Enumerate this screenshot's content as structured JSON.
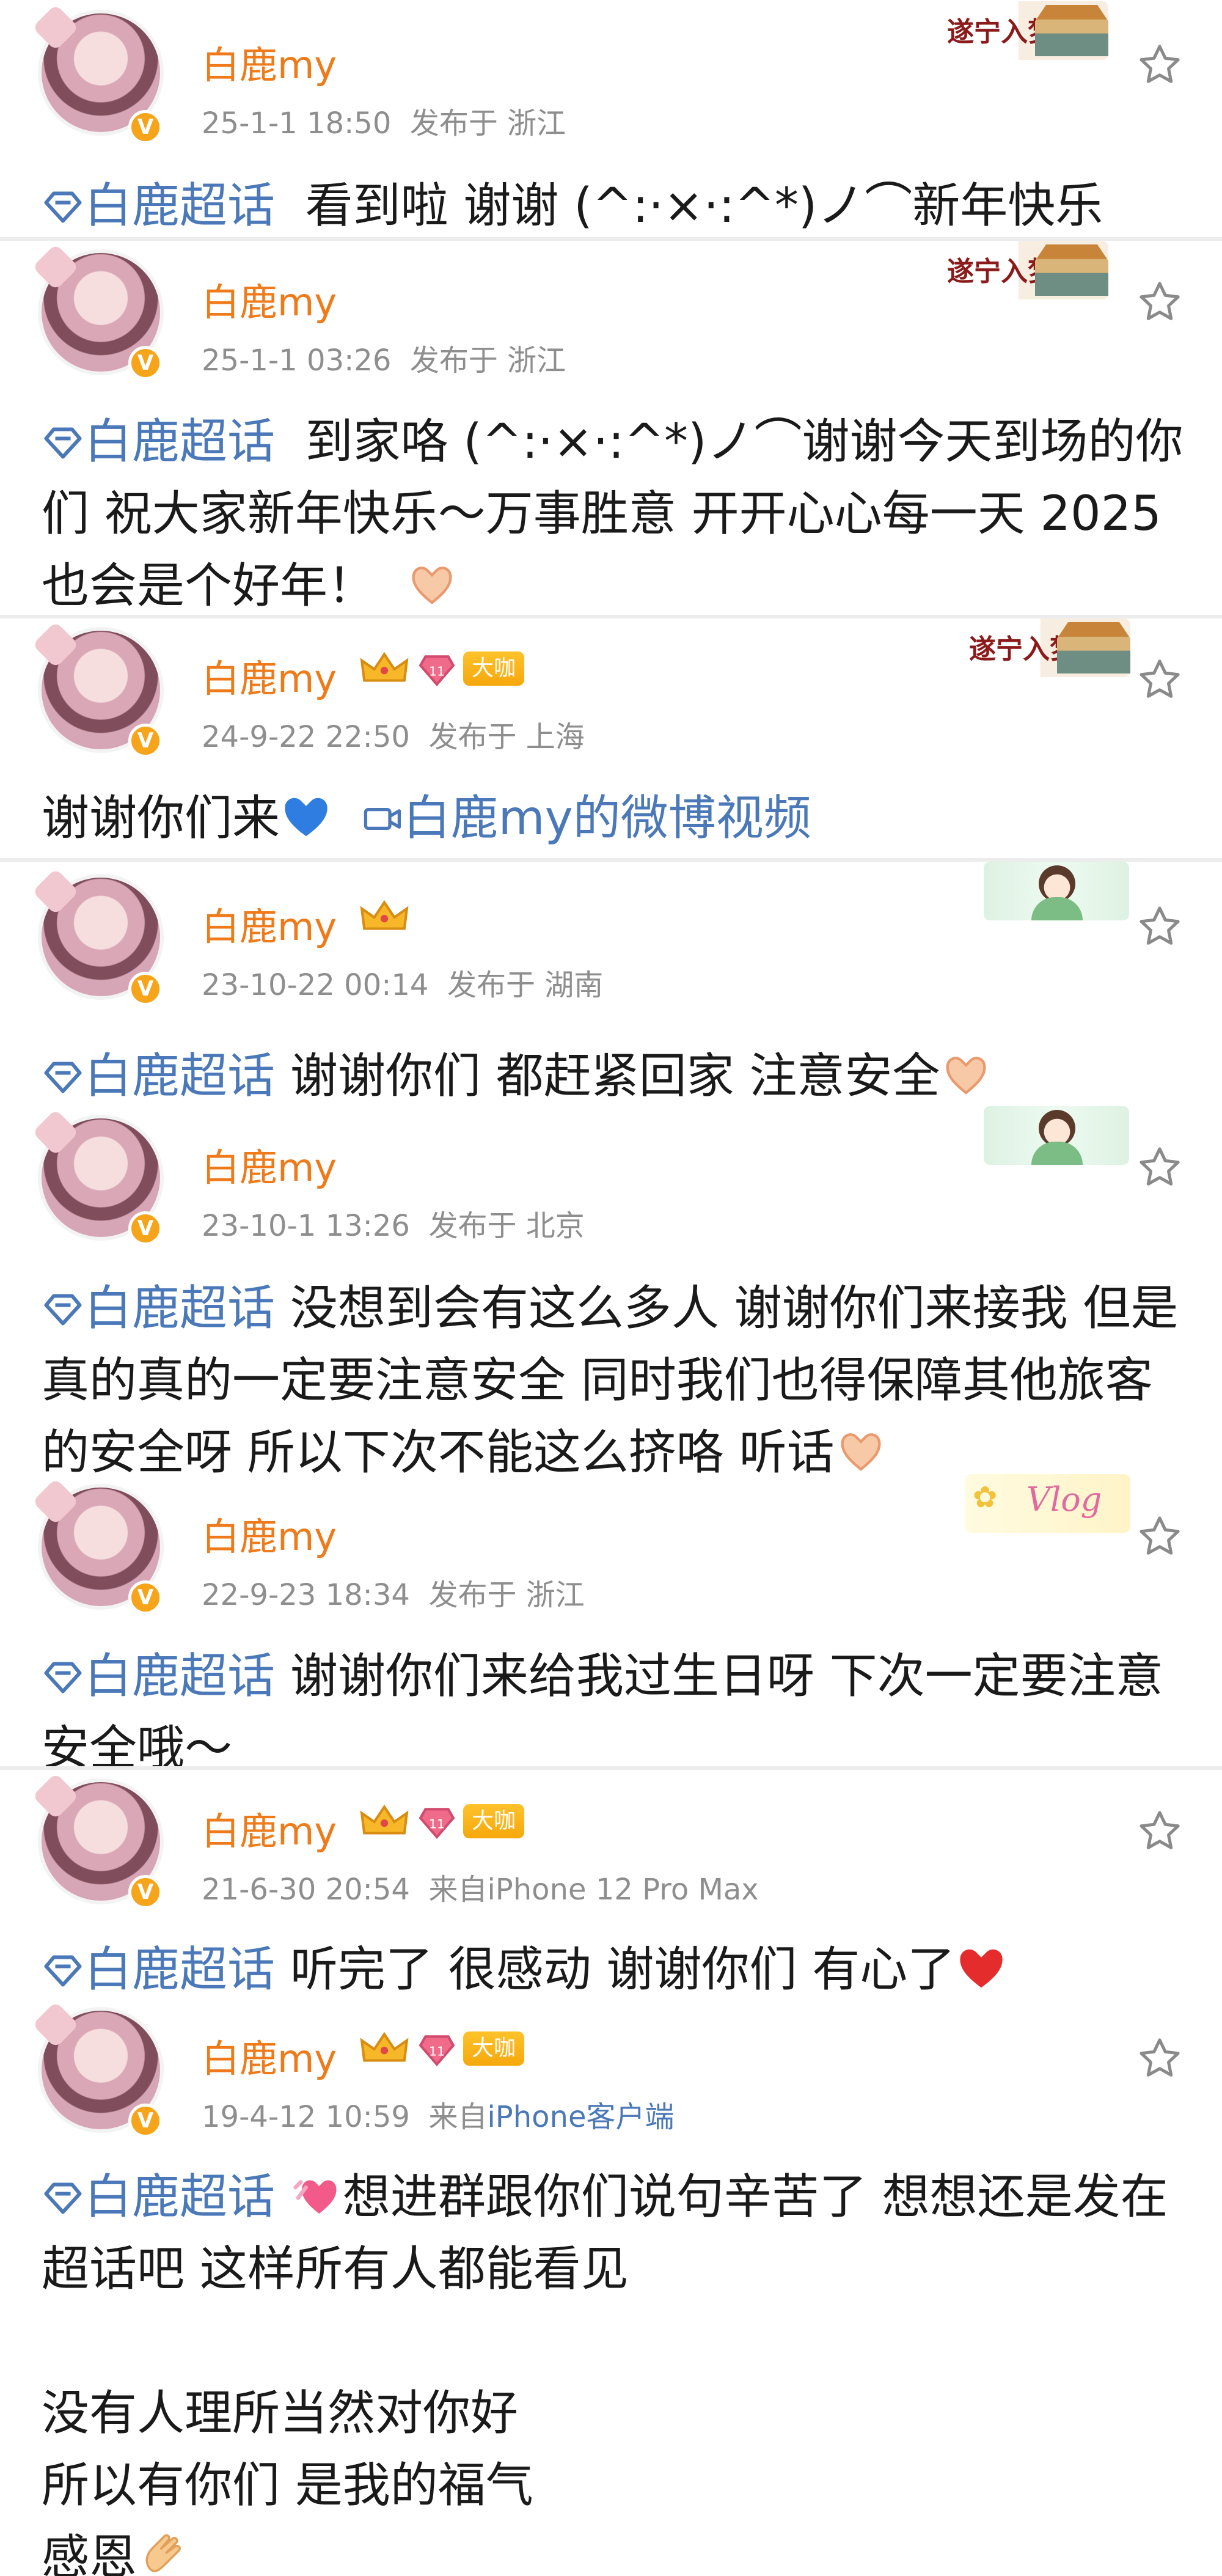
{
  "posts": [
    {
      "username": "白鹿my",
      "timestamp": "25-1-1 18:50",
      "source": "发布于 浙江",
      "badges": [],
      "decoration": "suining",
      "decoration_text": "遂宁入梦",
      "topic": "白鹿超话",
      "text": "看到啦 谢谢 (^:·×·:^*)ノ⌒新年快乐",
      "emoji": []
    },
    {
      "username": "白鹿my",
      "timestamp": "25-1-1 03:26",
      "source": "发布于 浙江",
      "badges": [],
      "decoration": "suining",
      "decoration_text": "遂宁入梦",
      "topic": "白鹿超话",
      "text": "到家咯 (^:·×·:^*)ノ⌒谢谢今天到场的你们 祝大家新年快乐～万事胜意 开开心心每一天 2025也会是个好年！",
      "emoji": [
        "heart-hands-emoji"
      ]
    },
    {
      "username": "白鹿my",
      "timestamp": "24-9-22 22:50",
      "source": "发布于 上海",
      "badges": [
        "crown",
        "vip",
        "大咖"
      ],
      "decoration": "suining",
      "decoration_text": "遂宁入梦",
      "text": "谢谢你们来",
      "video_link": "白鹿my的微博视频",
      "emoji": [
        "blue-heart-emoji"
      ]
    },
    {
      "username": "白鹿my",
      "timestamp": "23-10-22 00:14",
      "source": "发布于 湖南",
      "badges": [
        "crown"
      ],
      "decoration": "girl",
      "topic": "白鹿超话",
      "text": "谢谢你们 都赶紧回家 注意安全",
      "emoji": [
        "heart-hands-emoji"
      ]
    },
    {
      "username": "白鹿my",
      "timestamp": "23-10-1 13:26",
      "source": "发布于 北京",
      "badges": [],
      "decoration": "girl",
      "topic": "白鹿超话",
      "text": "没想到会有这么多人 谢谢你们来接我 但是真的真的一定要注意安全 同时我们也得保障其他旅客的安全呀 所以下次不能这么挤咯 听话",
      "emoji": [
        "heart-hands-emoji"
      ]
    },
    {
      "username": "白鹿my",
      "timestamp": "22-9-23 18:34",
      "source": "发布于 浙江",
      "badges": [],
      "decoration": "vlog",
      "decoration_text": "Vlog",
      "topic": "白鹿超话",
      "text": "谢谢你们来给我过生日呀 下次一定要注意安全哦～",
      "emoji": []
    },
    {
      "username": "白鹿my",
      "timestamp": "21-6-30 20:54",
      "source_prefix": "来自",
      "source": "iPhone 12 Pro Max",
      "badges": [
        "crown",
        "vip",
        "大咖"
      ],
      "decoration": "none",
      "topic": "白鹿超话",
      "text": "听完了 很感动 谢谢你们 有心了",
      "emoji": [
        "red-heart-emoji"
      ]
    },
    {
      "username": "白鹿my",
      "timestamp": "19-4-12 10:59",
      "source_prefix": "来自",
      "source": "iPhone客户端",
      "badges": [
        "crown",
        "vip",
        "大咖"
      ],
      "decoration": "none",
      "topic": "白鹿超话",
      "text_line1": "想进群跟你们说句辛苦了 想想还是发在超话吧 这样所有人都能看见",
      "text_line2": "没有人理所当然对你好\n所以有你们 是我的福气\n感恩",
      "emoji": [
        "heart-gift-emoji",
        "clap-emoji"
      ]
    }
  ],
  "colors": {
    "username": "#ee7a1a",
    "meta": "#8e8e8e",
    "link": "#4a78b8",
    "text": "#1a1a1a",
    "badge_gold": "#f6a51b"
  },
  "icons": [
    "verified-icon",
    "crown-icon",
    "vip-icon",
    "star-icon",
    "topic-diamond-icon",
    "camera-icon"
  ]
}
